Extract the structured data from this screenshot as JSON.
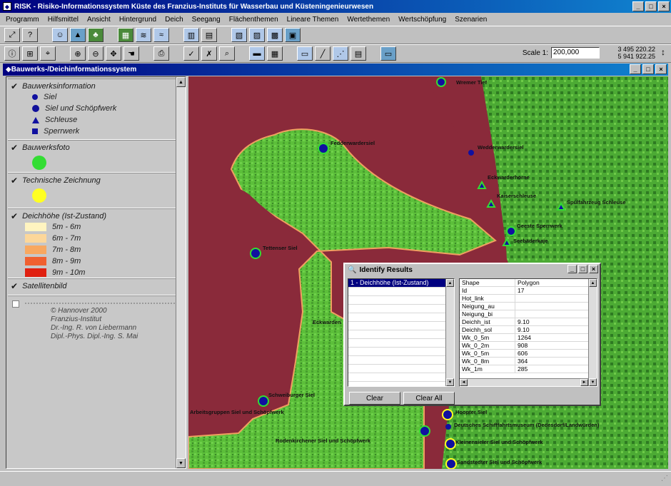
{
  "app": {
    "title": "RISK - Risiko-Informationssystem Küste des Franzius-Instituts für Wasserbau und Küsteningenieurwesen",
    "window_controls": [
      "_",
      "□",
      "×"
    ]
  },
  "menu": [
    "Programm",
    "Hilfsmittel",
    "Ansicht",
    "Hintergrund",
    "Deich",
    "Seegang",
    "Flächenthemen",
    "Lineare Themen",
    "Wertethemen",
    "Wertschöpfung",
    "Szenarien"
  ],
  "scale": {
    "label": "Scale 1:",
    "value": "200,000"
  },
  "coords": {
    "line1": "3 495 220.22",
    "line2": "5 941 922.25"
  },
  "mdi_title": "Bauwerks-/Deichinformationssystem",
  "legend": {
    "groups": [
      {
        "title": "Bauwerksinformation",
        "checked": true,
        "items": [
          {
            "label": "Siel",
            "symbol": "dot"
          },
          {
            "label": "Siel und Schöpfwerk",
            "symbol": "dot-big"
          },
          {
            "label": "Schleuse",
            "symbol": "triangle"
          },
          {
            "label": "Sperrwerk",
            "symbol": "square"
          }
        ]
      },
      {
        "title": "Bauwerksfoto",
        "checked": true,
        "color": "#33dd33"
      },
      {
        "title": "Technische Zeichnung",
        "checked": true,
        "color": "#ffff22"
      },
      {
        "title": "Deichhöhe (Ist-Zustand)",
        "checked": true,
        "items": [
          {
            "label": "5m - 6m",
            "color": "#fff4c0"
          },
          {
            "label": "6m - 7m",
            "color": "#fcd79a"
          },
          {
            "label": "7m - 8m",
            "color": "#f8a860"
          },
          {
            "label": "8m - 9m",
            "color": "#f06030"
          },
          {
            "label": "9m - 10m",
            "color": "#e02010"
          }
        ]
      },
      {
        "title": "Satellitenbild",
        "checked": true
      }
    ],
    "credits": [
      "© Hannover 2000",
      "Franzius-Institut",
      "Dr.-Ing. R. von Liebermann",
      "Dipl.-Phys. Dipl.-Ing. S. Mai"
    ]
  },
  "map": {
    "labels": [
      "Wremer Tief",
      "Fedderwardersiel",
      "Wedderwardersiel",
      "Eckwarderhörne",
      "Kaiserschleuse",
      "Spülfahrzeug Schleuse",
      "Seebäderkaje",
      "Geeste Sperrwerk",
      "Tettenser Siel",
      "Eckwarden",
      "Schweiburger Siel",
      "Arbeitsgruppen Siel und Schöpfwerk",
      "Hoopter Siel",
      "Deutsches Schifffahrtsmuseum (Dedesdorf/Landwürden)",
      "Rodenkirchener Siel und Schöpfwerk",
      "Kleinensieler Siel und Schöpfwerk",
      "Sandstedter Siel und Schöpfwerk",
      "Eckwarden/Sielort"
    ]
  },
  "identify": {
    "title": "Identify Results",
    "list": [
      "1 - Deichhöhe (Ist-Zustand)"
    ],
    "columns": [
      "Shape",
      "Polygon"
    ],
    "rows": [
      [
        "Id",
        "17"
      ],
      [
        "Hot_link",
        ""
      ],
      [
        "Neigung_au",
        ""
      ],
      [
        "Neigung_bi",
        ""
      ],
      [
        "Deichh_ist",
        "9.10"
      ],
      [
        "Deichh_sol",
        "9.10"
      ],
      [
        "Wk_0_5m",
        "1264"
      ],
      [
        "Wk_0_2m",
        "908"
      ],
      [
        "Wk_0_5m",
        "606"
      ],
      [
        "Wk_0_8m",
        "364"
      ],
      [
        "Wk_1m",
        "285"
      ]
    ],
    "clear_label": "Clear",
    "clear_all_label": "Clear All"
  }
}
